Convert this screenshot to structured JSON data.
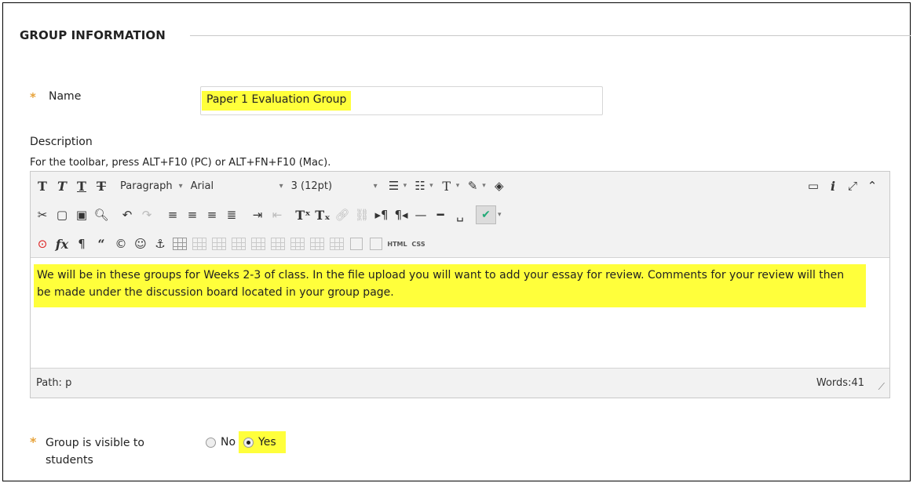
{
  "section": {
    "title": "GROUP INFORMATION"
  },
  "name_field": {
    "label": "Name",
    "required_mark": "*",
    "value": "Paper 1 Evaluation Group"
  },
  "description": {
    "label": "Description",
    "hint": "For the toolbar, press ALT+F10 (PC) or ALT+FN+F10 (Mac).",
    "toolbar": {
      "format_select": "Paragraph",
      "font_select": "Arial",
      "size_select": "3 (12pt)",
      "html_label": "HTML",
      "css_label": "CSS"
    },
    "content": "We will be in these groups for Weeks 2-3 of class. In the file upload you will want to add your essay for review. Comments for your review will then be made under the discussion board located in your group page.",
    "path": "Path: p",
    "word_count": "Words:41"
  },
  "visibility": {
    "label": "Group is visible to students",
    "required_mark": "*",
    "options": [
      "No",
      "Yes"
    ],
    "selected": "Yes"
  },
  "colors": {
    "highlight": "#ffff3b",
    "required": "#e7a33b"
  }
}
